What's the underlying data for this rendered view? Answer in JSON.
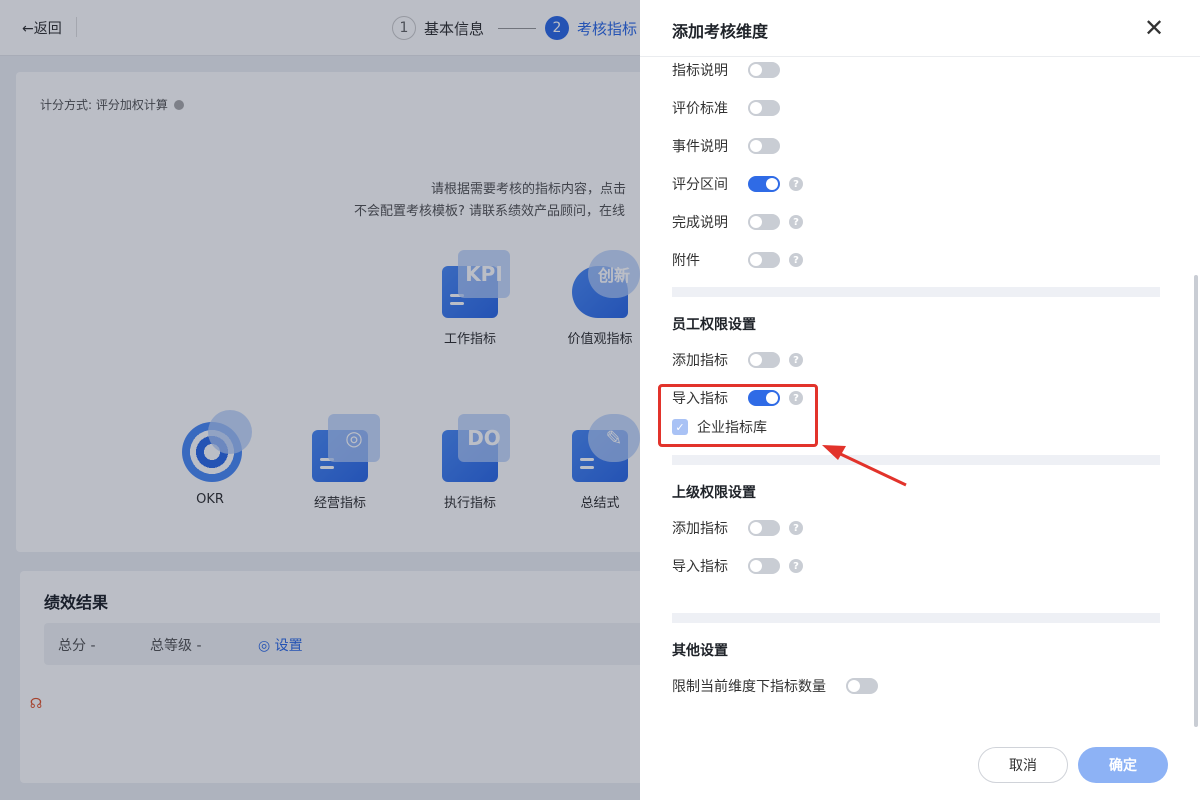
{
  "header": {
    "back_label": "←返回",
    "steps": [
      {
        "num": "1",
        "label": "基本信息"
      },
      {
        "num": "2",
        "label": "考核指标"
      }
    ]
  },
  "background": {
    "score_mode": "计分方式: 评分加权计算",
    "tip_line1": "请根据需要考核的指标内容，点击",
    "tip_line2": "不会配置考核模板? 请联系绩效产品顾问，在线",
    "templates": [
      {
        "label": "工作指标",
        "icon": "kpi-icon",
        "badge": "KPI"
      },
      {
        "label": "价值观指标",
        "icon": "innovation-icon",
        "badge": "创新"
      },
      {
        "label": "OKR",
        "icon": "target-icon",
        "badge": ""
      },
      {
        "label": "经营指标",
        "icon": "business-target-icon",
        "badge": "◎"
      },
      {
        "label": "执行指标",
        "icon": "todo-icon",
        "badge": "DO"
      },
      {
        "label": "总结式",
        "icon": "summary-pen-icon",
        "badge": "✎"
      }
    ],
    "performance": {
      "title": "绩效结果",
      "total_score": "总分  -",
      "total_grade": "总等级  -",
      "settings": "◎ 设置"
    }
  },
  "drawer": {
    "title": "添加考核维度",
    "close_symbol": "✕",
    "fields": [
      {
        "label": "指标说明",
        "on": false,
        "help": false
      },
      {
        "label": "评价标准",
        "on": false,
        "help": false
      },
      {
        "label": "事件说明",
        "on": false,
        "help": false
      },
      {
        "label": "评分区间",
        "on": true,
        "help": true
      },
      {
        "label": "完成说明",
        "on": false,
        "help": true
      },
      {
        "label": "附件",
        "on": false,
        "help": true
      }
    ],
    "employee_section": {
      "title": "员工权限设置",
      "items": [
        {
          "label": "添加指标",
          "on": false
        },
        {
          "label": "导入指标",
          "on": true
        }
      ],
      "checkbox_label": "企业指标库",
      "checkbox_checked": true
    },
    "superior_section": {
      "title": "上级权限设置",
      "items": [
        {
          "label": "添加指标",
          "on": false
        },
        {
          "label": "导入指标",
          "on": false
        }
      ]
    },
    "other_section": {
      "title": "其他设置",
      "items": [
        {
          "label": "限制当前维度下指标数量",
          "on": false
        }
      ]
    },
    "help_symbol": "?",
    "cancel_label": "取消",
    "confirm_label": "确定"
  },
  "annotation": {
    "highlight_color": "#e2332b"
  }
}
